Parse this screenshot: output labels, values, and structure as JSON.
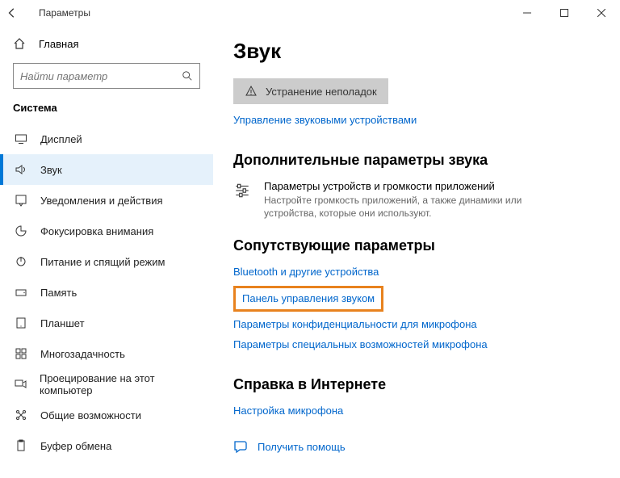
{
  "titlebar": {
    "title": "Параметры"
  },
  "sidebar": {
    "home_label": "Главная",
    "search_placeholder": "Найти параметр",
    "section_label": "Система",
    "items": [
      {
        "label": "Дисплей"
      },
      {
        "label": "Звук"
      },
      {
        "label": "Уведомления и действия"
      },
      {
        "label": "Фокусировка внимания"
      },
      {
        "label": "Питание и спящий режим"
      },
      {
        "label": "Память"
      },
      {
        "label": "Планшет"
      },
      {
        "label": "Многозадачность"
      },
      {
        "label": "Проецирование на этот компьютер"
      },
      {
        "label": "Общие возможности"
      },
      {
        "label": "Буфер обмена"
      }
    ]
  },
  "main": {
    "heading": "Звук",
    "troubleshoot_label": "Устранение неполадок",
    "manage_devices": "Управление звуковыми устройствами",
    "advanced_heading": "Дополнительные параметры звука",
    "app_row": {
      "title": "Параметры устройств и громкости приложений",
      "desc": "Настройте громкость приложений, а также динамики или устройства, которые они используют."
    },
    "related_heading": "Сопутствующие параметры",
    "related_links": [
      "Bluetooth и другие устройства",
      "Панель управления звуком",
      "Параметры конфиденциальности для микрофона",
      "Параметры специальных возможностей микрофона"
    ],
    "web_help_heading": "Справка в Интернете",
    "web_help_link": "Настройка микрофона",
    "get_help": "Получить помощь"
  }
}
